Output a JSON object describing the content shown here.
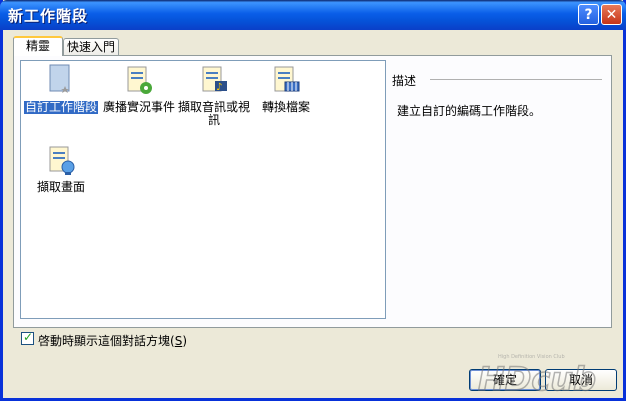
{
  "window": {
    "title": "新工作階段"
  },
  "tabs": [
    {
      "label": "精靈",
      "active": true
    },
    {
      "label": "快速入門",
      "active": false
    }
  ],
  "items": [
    {
      "label": "自訂工作階段",
      "icon": "custom-session-icon",
      "selected": true
    },
    {
      "label": "廣播實況事件",
      "icon": "broadcast-icon",
      "selected": false
    },
    {
      "label": "擷取音訊或視訊",
      "icon": "capture-av-icon",
      "selected": false
    },
    {
      "label": "轉換檔案",
      "icon": "convert-file-icon",
      "selected": false
    },
    {
      "label": "擷取畫面",
      "icon": "capture-screen-icon",
      "selected": false
    }
  ],
  "description": {
    "header": "描述",
    "text": "建立自訂的編碼工作階段。"
  },
  "startup_checkbox": {
    "label_prefix": "啓動時顯示這個對話方塊(",
    "accel": "S",
    "label_suffix": ")",
    "checked": true
  },
  "buttons": {
    "ok": "確定",
    "cancel": "取消"
  },
  "watermark": {
    "text": "HDcub",
    "subtitle": "High Definition Vision Club"
  },
  "colors": {
    "titlebar": "#0a5ee8",
    "selection": "#316ac5",
    "face": "#ece9d8"
  }
}
